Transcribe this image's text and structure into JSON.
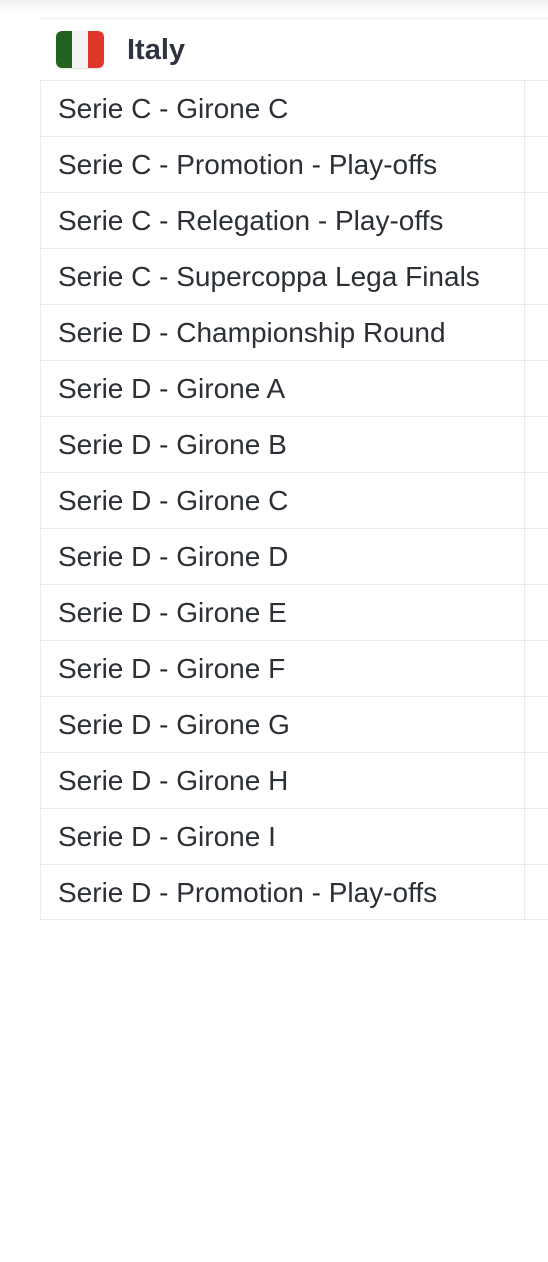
{
  "country": {
    "name": "Italy",
    "flag_icon": "italy-flag-icon",
    "flag_colors": [
      "#23621e",
      "#f3f3f3",
      "#e0352b"
    ]
  },
  "leagues": [
    {
      "label": "Serie C - Girone C"
    },
    {
      "label": "Serie C - Promotion - Play-offs"
    },
    {
      "label": "Serie C - Relegation - Play-offs"
    },
    {
      "label": "Serie C - Supercoppa Lega Finals"
    },
    {
      "label": "Serie D - Championship Round"
    },
    {
      "label": "Serie D - Girone A"
    },
    {
      "label": "Serie D - Girone B"
    },
    {
      "label": "Serie D - Girone C"
    },
    {
      "label": "Serie D - Girone D"
    },
    {
      "label": "Serie D - Girone E"
    },
    {
      "label": "Serie D - Girone F"
    },
    {
      "label": "Serie D - Girone G"
    },
    {
      "label": "Serie D - Girone H"
    },
    {
      "label": "Serie D - Girone I"
    },
    {
      "label": "Serie D - Promotion - Play-offs"
    }
  ]
}
